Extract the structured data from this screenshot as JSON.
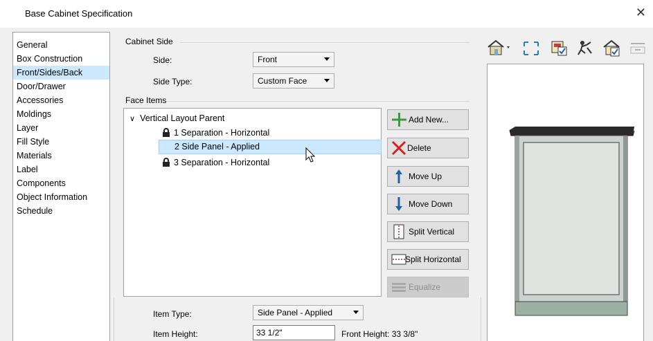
{
  "window": {
    "title": "Base Cabinet Specification",
    "close_glyph": "✕"
  },
  "nav": {
    "items": [
      {
        "label": "General"
      },
      {
        "label": "Box Construction"
      },
      {
        "label": "Front/Sides/Back",
        "selected": true
      },
      {
        "label": "Door/Drawer"
      },
      {
        "label": "Accessories"
      },
      {
        "label": "Moldings"
      },
      {
        "label": "Layer"
      },
      {
        "label": "Fill Style"
      },
      {
        "label": "Materials"
      },
      {
        "label": "Label"
      },
      {
        "label": "Components"
      },
      {
        "label": "Object Information"
      },
      {
        "label": "Schedule"
      }
    ]
  },
  "cabinet_side": {
    "group_label": "Cabinet Side",
    "side_label": "Side:",
    "side_value": "Front",
    "side_type_label": "Side Type:",
    "side_type_value": "Custom Face"
  },
  "face_items": {
    "group_label": "Face Items",
    "tree": {
      "expand_glyph": "∨",
      "parent_label": "Vertical Layout Parent",
      "children": [
        {
          "label": "1 Separation - Horizontal",
          "locked": true
        },
        {
          "label": "2 Side Panel - Applied",
          "locked": false,
          "selected": true
        },
        {
          "label": "3 Separation - Horizontal",
          "locked": true
        }
      ]
    },
    "buttons": {
      "add_new": "Add New...",
      "delete": "Delete",
      "move_up": "Move Up",
      "move_down": "Move Down",
      "split_vertical": "Split Vertical",
      "split_horizontal": "Split Horizontal",
      "equalize": "Equalize"
    }
  },
  "item": {
    "type_label": "Item Type:",
    "type_value": "Side Panel - Applied",
    "height_label": "Item Height:",
    "height_value": "33 1/2\"",
    "front_height_label": "Front Height:",
    "front_height_value": "33 3/8\""
  },
  "toolbar": {
    "icons": [
      "render-technique-icon",
      "fill-window-icon",
      "show-selected-icon",
      "orbit-camera-icon",
      "color-preview-icon",
      "show-all-icon"
    ]
  },
  "colors": {
    "selection": "#cce8ff",
    "add_green": "#3a9a3a",
    "delete_red": "#d42020",
    "arrow_blue": "#1f5fa8",
    "cabinet_panel": "#d9dedb",
    "cabinet_top": "#2a2a2a"
  }
}
